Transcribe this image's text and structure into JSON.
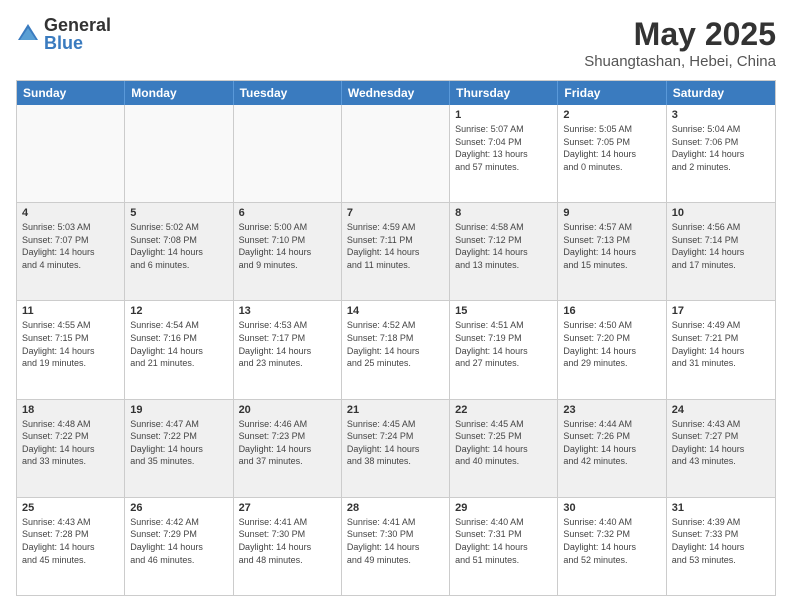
{
  "logo": {
    "general": "General",
    "blue": "Blue"
  },
  "title": "May 2025",
  "subtitle": "Shuangtashan, Hebei, China",
  "header_days": [
    "Sunday",
    "Monday",
    "Tuesday",
    "Wednesday",
    "Thursday",
    "Friday",
    "Saturday"
  ],
  "rows": [
    [
      {
        "day": "",
        "info": ""
      },
      {
        "day": "",
        "info": ""
      },
      {
        "day": "",
        "info": ""
      },
      {
        "day": "",
        "info": ""
      },
      {
        "day": "1",
        "info": "Sunrise: 5:07 AM\nSunset: 7:04 PM\nDaylight: 13 hours\nand 57 minutes."
      },
      {
        "day": "2",
        "info": "Sunrise: 5:05 AM\nSunset: 7:05 PM\nDaylight: 14 hours\nand 0 minutes."
      },
      {
        "day": "3",
        "info": "Sunrise: 5:04 AM\nSunset: 7:06 PM\nDaylight: 14 hours\nand 2 minutes."
      }
    ],
    [
      {
        "day": "4",
        "info": "Sunrise: 5:03 AM\nSunset: 7:07 PM\nDaylight: 14 hours\nand 4 minutes."
      },
      {
        "day": "5",
        "info": "Sunrise: 5:02 AM\nSunset: 7:08 PM\nDaylight: 14 hours\nand 6 minutes."
      },
      {
        "day": "6",
        "info": "Sunrise: 5:00 AM\nSunset: 7:10 PM\nDaylight: 14 hours\nand 9 minutes."
      },
      {
        "day": "7",
        "info": "Sunrise: 4:59 AM\nSunset: 7:11 PM\nDaylight: 14 hours\nand 11 minutes."
      },
      {
        "day": "8",
        "info": "Sunrise: 4:58 AM\nSunset: 7:12 PM\nDaylight: 14 hours\nand 13 minutes."
      },
      {
        "day": "9",
        "info": "Sunrise: 4:57 AM\nSunset: 7:13 PM\nDaylight: 14 hours\nand 15 minutes."
      },
      {
        "day": "10",
        "info": "Sunrise: 4:56 AM\nSunset: 7:14 PM\nDaylight: 14 hours\nand 17 minutes."
      }
    ],
    [
      {
        "day": "11",
        "info": "Sunrise: 4:55 AM\nSunset: 7:15 PM\nDaylight: 14 hours\nand 19 minutes."
      },
      {
        "day": "12",
        "info": "Sunrise: 4:54 AM\nSunset: 7:16 PM\nDaylight: 14 hours\nand 21 minutes."
      },
      {
        "day": "13",
        "info": "Sunrise: 4:53 AM\nSunset: 7:17 PM\nDaylight: 14 hours\nand 23 minutes."
      },
      {
        "day": "14",
        "info": "Sunrise: 4:52 AM\nSunset: 7:18 PM\nDaylight: 14 hours\nand 25 minutes."
      },
      {
        "day": "15",
        "info": "Sunrise: 4:51 AM\nSunset: 7:19 PM\nDaylight: 14 hours\nand 27 minutes."
      },
      {
        "day": "16",
        "info": "Sunrise: 4:50 AM\nSunset: 7:20 PM\nDaylight: 14 hours\nand 29 minutes."
      },
      {
        "day": "17",
        "info": "Sunrise: 4:49 AM\nSunset: 7:21 PM\nDaylight: 14 hours\nand 31 minutes."
      }
    ],
    [
      {
        "day": "18",
        "info": "Sunrise: 4:48 AM\nSunset: 7:22 PM\nDaylight: 14 hours\nand 33 minutes."
      },
      {
        "day": "19",
        "info": "Sunrise: 4:47 AM\nSunset: 7:22 PM\nDaylight: 14 hours\nand 35 minutes."
      },
      {
        "day": "20",
        "info": "Sunrise: 4:46 AM\nSunset: 7:23 PM\nDaylight: 14 hours\nand 37 minutes."
      },
      {
        "day": "21",
        "info": "Sunrise: 4:45 AM\nSunset: 7:24 PM\nDaylight: 14 hours\nand 38 minutes."
      },
      {
        "day": "22",
        "info": "Sunrise: 4:45 AM\nSunset: 7:25 PM\nDaylight: 14 hours\nand 40 minutes."
      },
      {
        "day": "23",
        "info": "Sunrise: 4:44 AM\nSunset: 7:26 PM\nDaylight: 14 hours\nand 42 minutes."
      },
      {
        "day": "24",
        "info": "Sunrise: 4:43 AM\nSunset: 7:27 PM\nDaylight: 14 hours\nand 43 minutes."
      }
    ],
    [
      {
        "day": "25",
        "info": "Sunrise: 4:43 AM\nSunset: 7:28 PM\nDaylight: 14 hours\nand 45 minutes."
      },
      {
        "day": "26",
        "info": "Sunrise: 4:42 AM\nSunset: 7:29 PM\nDaylight: 14 hours\nand 46 minutes."
      },
      {
        "day": "27",
        "info": "Sunrise: 4:41 AM\nSunset: 7:30 PM\nDaylight: 14 hours\nand 48 minutes."
      },
      {
        "day": "28",
        "info": "Sunrise: 4:41 AM\nSunset: 7:30 PM\nDaylight: 14 hours\nand 49 minutes."
      },
      {
        "day": "29",
        "info": "Sunrise: 4:40 AM\nSunset: 7:31 PM\nDaylight: 14 hours\nand 51 minutes."
      },
      {
        "day": "30",
        "info": "Sunrise: 4:40 AM\nSunset: 7:32 PM\nDaylight: 14 hours\nand 52 minutes."
      },
      {
        "day": "31",
        "info": "Sunrise: 4:39 AM\nSunset: 7:33 PM\nDaylight: 14 hours\nand 53 minutes."
      }
    ]
  ]
}
